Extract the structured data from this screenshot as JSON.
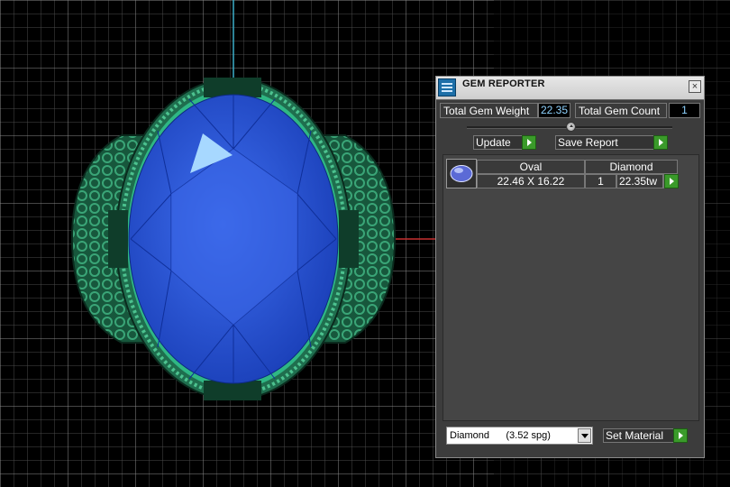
{
  "viewport": {
    "gem_color": "#2a55d6",
    "metal_color": "#1f6e4e",
    "rim_color": "#2fb784",
    "grid_color": "#7a7a7a",
    "axis_y_color": "#3aaec8",
    "axis_x_color": "#c83030"
  },
  "panel": {
    "title": "GEM REPORTER",
    "app_icon": "gem-reporter-icon",
    "close_icon": "close-icon",
    "close_label": "×",
    "total_weight_label": "Total Gem Weight",
    "total_weight_value": "22.35",
    "total_count_label": "Total Gem Count",
    "total_count_value": "1",
    "update_label": "Update",
    "save_report_label": "Save Report",
    "table": {
      "thumb_icon": "oval-gem-icon",
      "header_shape": "Oval",
      "header_material": "Diamond",
      "dimensions": "22.46 X 16.22",
      "count": "1",
      "weight": "22.35tw"
    },
    "material_select": "Diamond      (3.52 spg)",
    "set_material_label": "Set Material"
  }
}
